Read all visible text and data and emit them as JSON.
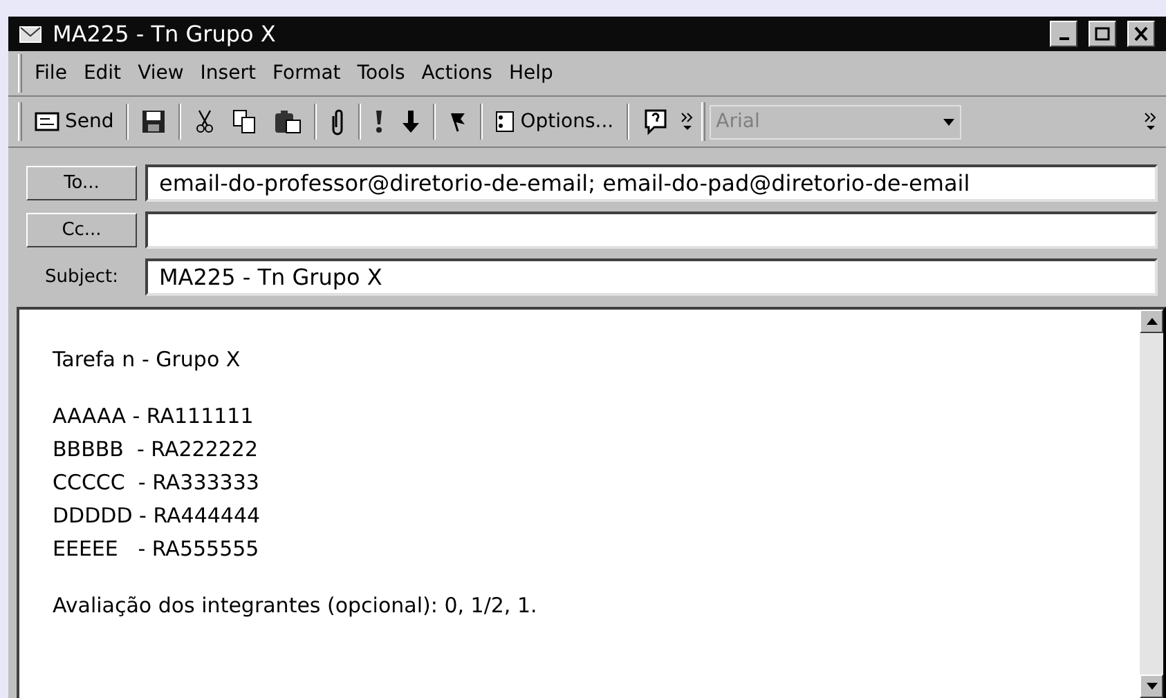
{
  "window": {
    "title": "MA225 - Tn Grupo X"
  },
  "menu": [
    "File",
    "Edit",
    "View",
    "Insert",
    "Format",
    "Tools",
    "Actions",
    "Help"
  ],
  "toolbar": {
    "send": "Send",
    "options": "Options...",
    "font": "Arial"
  },
  "fields": [
    {
      "kind": "button",
      "label": "To...",
      "value": "email-do-professor@diretorio-de-email; email-do-pad@diretorio-de-email"
    },
    {
      "kind": "button",
      "label": "Cc..."
    },
    {
      "kind": "label",
      "label": "Subject:",
      "value": "MA225 - Tn Grupo X"
    }
  ],
  "body": [
    [
      "Tarefa n - Grupo X"
    ],
    [
      "AAAAA - RA111111",
      "BBBBB  - RA222222",
      "CCCCC  - RA333333",
      "DDDDD - RA444444",
      "EEEEE   - RA555555"
    ],
    [
      "Avaliação dos integrantes (opcional): 0, 1/2, 1."
    ]
  ]
}
